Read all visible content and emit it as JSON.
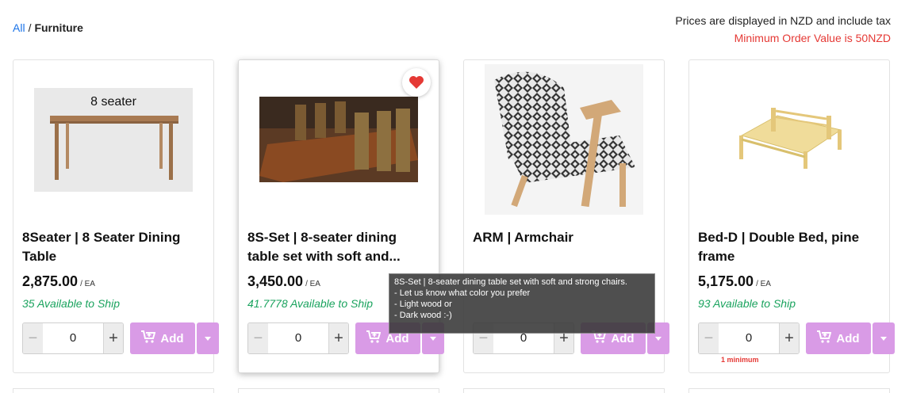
{
  "breadcrumb": {
    "root": "All",
    "separator": "/",
    "current": "Furniture"
  },
  "notice": {
    "tax": "Prices are displayed in NZD and include tax",
    "minimum": "Minimum Order Value is 50NZD"
  },
  "products": [
    {
      "image_label": "8 seater",
      "title": "8Seater | 8 Seater Dining Table",
      "price": "2,875.00",
      "unit": "/ EA",
      "availability": "35 Available to Ship",
      "qty": "0",
      "add_label": "Add"
    },
    {
      "title": "8S-Set | 8-seater dining table set with soft and...",
      "price": "3,450.00",
      "unit": "/ EA",
      "availability": "41.7778 Available to Ship",
      "qty": "0",
      "add_label": "Add",
      "favorited": true
    },
    {
      "title": "ARM | Armchair",
      "qty": "0",
      "add_label": "Add"
    },
    {
      "title": "Bed-D | Double Bed, pine frame",
      "price": "5,175.00",
      "unit": "/ EA",
      "availability": "93 Available to Ship",
      "qty": "0",
      "add_label": "Add",
      "min_note": "1 minimum"
    }
  ],
  "tooltip": "8S-Set | 8-seater dining table set with soft and strong chairs.\n- Let us know what color you prefer\n- Light wood or\n- Dark wood :-)",
  "colors": {
    "link": "#1a73e8",
    "warning": "#e53935",
    "available": "#1aa35e",
    "button": "#d99be6"
  }
}
